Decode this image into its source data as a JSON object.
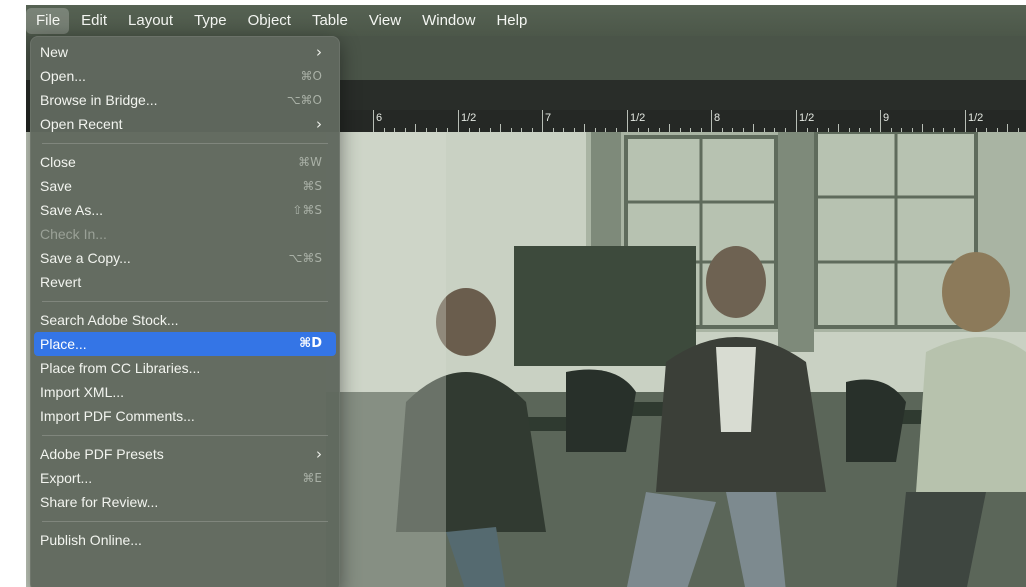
{
  "menubar": {
    "items": [
      "File",
      "Edit",
      "Layout",
      "Type",
      "Object",
      "Table",
      "View",
      "Window",
      "Help"
    ]
  },
  "ruler": {
    "labels": [
      "6",
      "1/2",
      "7",
      "1/2",
      "8",
      "1/2",
      "9",
      "1/2"
    ]
  },
  "file_menu": {
    "groups": [
      [
        {
          "label": "New",
          "shortcut": "",
          "submenu": true,
          "disabled": false
        },
        {
          "label": "Open...",
          "shortcut": "⌘O",
          "submenu": false,
          "disabled": false
        },
        {
          "label": "Browse in Bridge...",
          "shortcut": "⌥⌘O",
          "submenu": false,
          "disabled": false
        },
        {
          "label": "Open Recent",
          "shortcut": "",
          "submenu": true,
          "disabled": false
        }
      ],
      [
        {
          "label": "Close",
          "shortcut": "⌘W",
          "submenu": false,
          "disabled": false
        },
        {
          "label": "Save",
          "shortcut": "⌘S",
          "submenu": false,
          "disabled": false
        },
        {
          "label": "Save As...",
          "shortcut": "⇧⌘S",
          "submenu": false,
          "disabled": false
        },
        {
          "label": "Check In...",
          "shortcut": "",
          "submenu": false,
          "disabled": true
        },
        {
          "label": "Save a Copy...",
          "shortcut": "⌥⌘S",
          "submenu": false,
          "disabled": false
        },
        {
          "label": "Revert",
          "shortcut": "",
          "submenu": false,
          "disabled": false
        }
      ],
      [
        {
          "label": "Search Adobe Stock...",
          "shortcut": "",
          "submenu": false,
          "disabled": false
        },
        {
          "label": "Place...",
          "shortcut": "⌘D",
          "submenu": false,
          "disabled": false,
          "highlighted": true
        },
        {
          "label": "Place from CC Libraries...",
          "shortcut": "",
          "submenu": false,
          "disabled": false
        },
        {
          "label": "Import XML...",
          "shortcut": "",
          "submenu": false,
          "disabled": false
        },
        {
          "label": "Import PDF Comments...",
          "shortcut": "",
          "submenu": false,
          "disabled": false
        }
      ],
      [
        {
          "label": "Adobe PDF Presets",
          "shortcut": "",
          "submenu": true,
          "disabled": false
        },
        {
          "label": "Export...",
          "shortcut": "⌘E",
          "submenu": false,
          "disabled": false
        },
        {
          "label": "Share for Review...",
          "shortcut": "",
          "submenu": false,
          "disabled": false
        }
      ],
      [
        {
          "label": "Publish Online...",
          "shortcut": "",
          "submenu": false,
          "disabled": false
        }
      ]
    ]
  },
  "colors": {
    "highlight": "#3475e6",
    "photo_tint": "#c7cebf"
  }
}
